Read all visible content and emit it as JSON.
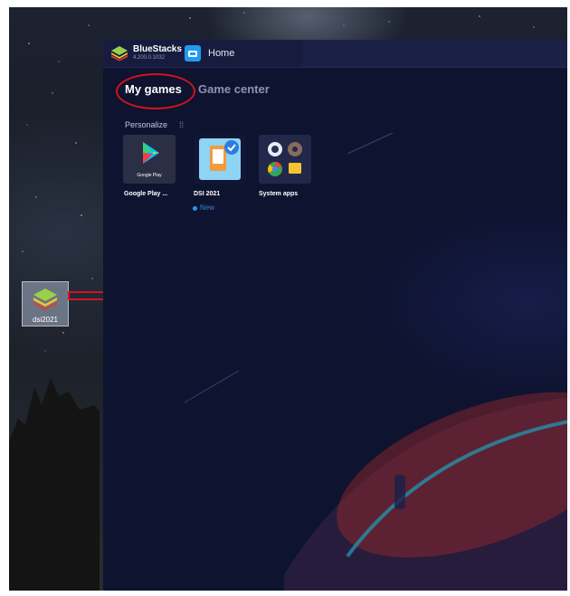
{
  "desktop": {
    "icon_label": "dsi2021",
    "icon_name": "bluestacks-app-icon"
  },
  "window": {
    "app_name": "BlueStacks",
    "version": "4.200.0.1032",
    "home_tab": "Home"
  },
  "tabs": [
    {
      "label": "My games",
      "selected": true
    },
    {
      "label": "Game center",
      "selected": false
    }
  ],
  "personalize": {
    "label": "Personalize",
    "icon": "settings-grid-icon"
  },
  "apps": [
    {
      "label": "Google Play ...",
      "icon": "google-play-icon",
      "caption": "Google Play"
    },
    {
      "label": "DSI 2021",
      "icon": "dsi-app-icon",
      "badge": "New"
    },
    {
      "label": "System apps",
      "icon": "system-apps-icon"
    }
  ],
  "colors": {
    "accent": "#1e9cf0",
    "annotation": "#d2141e",
    "window_bg": "#0f1430"
  }
}
